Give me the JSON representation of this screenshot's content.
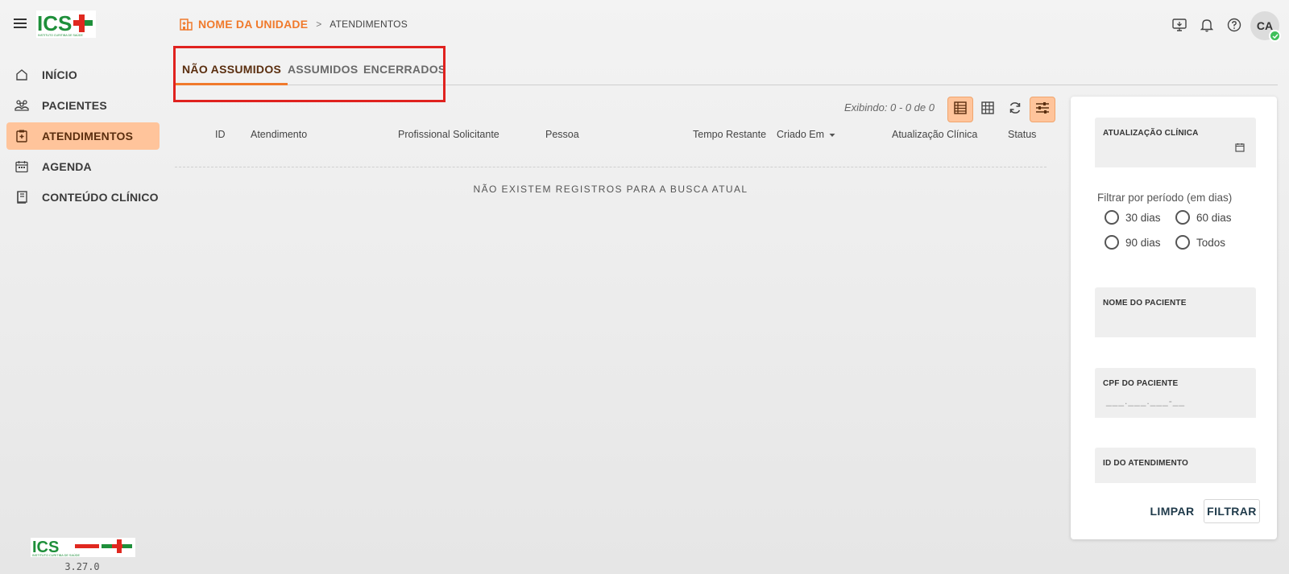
{
  "app": {
    "version": "3.27.0",
    "logo": {
      "text": "ICS",
      "subtitle": "INSTITUTO CURITIBA DE SAÚDE"
    }
  },
  "sidebar": {
    "items": [
      {
        "label": "INÍCIO",
        "icon": "home-icon",
        "active": false
      },
      {
        "label": "PACIENTES",
        "icon": "patients-icon",
        "active": false
      },
      {
        "label": "ATENDIMENTOS",
        "icon": "clipboard-icon",
        "active": true
      },
      {
        "label": "AGENDA",
        "icon": "calendar-icon",
        "active": false
      },
      {
        "label": "CONTEÚDO CLÍNICO",
        "icon": "book-icon",
        "active": false
      }
    ]
  },
  "header": {
    "unit": "NOME DA UNIDADE",
    "separator": ">",
    "page": "ATENDIMENTOS",
    "user_initials": "CA"
  },
  "tabs": [
    {
      "label": "NÃO ASSUMIDOS",
      "active": true
    },
    {
      "label": "ASSUMIDOS",
      "active": false
    },
    {
      "label": "ENCERRADOS",
      "active": false
    }
  ],
  "table": {
    "showing": "Exibindo: 0 - 0 de 0",
    "columns": [
      "ID",
      "Atendimento",
      "Profissional Solicitante",
      "Pessoa",
      "Tempo Restante",
      "Criado Em",
      "Atualização Clínica",
      "Status"
    ],
    "empty_message": "NÃO EXISTEM REGISTROS PARA A BUSCA ATUAL"
  },
  "filters": {
    "clinical_update": {
      "label": "ATUALIZAÇÃO CLÍNICA",
      "value": ""
    },
    "period_title": "Filtrar por período (em dias)",
    "period_options": [
      "30 dias",
      "60 dias",
      "90 dias",
      "Todos"
    ],
    "patient_name": {
      "label": "NOME DO PACIENTE",
      "value": ""
    },
    "patient_cpf": {
      "label": "CPF DO PACIENTE",
      "placeholder": "___.___.___-__"
    },
    "attendance_id": {
      "label": "ID DO ATENDIMENTO",
      "value": ""
    },
    "clear_label": "LIMPAR",
    "filter_label": "FILTRAR"
  },
  "colors": {
    "accent": "#f07a2c",
    "active_bg": "#ffc49b",
    "highlight": "#e0221f",
    "logo_green": "#1e8f3a",
    "logo_red": "#e0281f",
    "online": "#3fbf5a"
  }
}
